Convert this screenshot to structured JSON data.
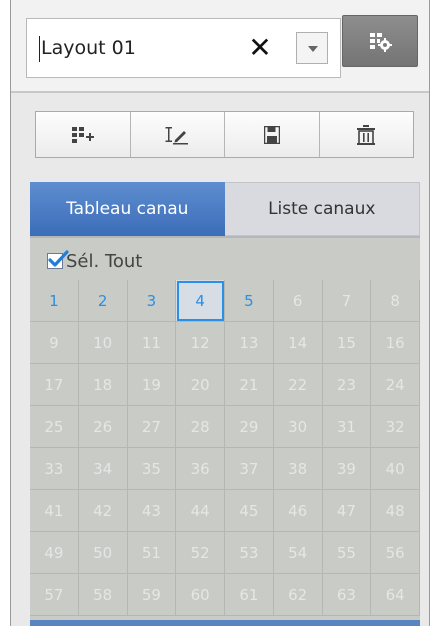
{
  "layout": {
    "value": "Layout 01",
    "clear_glyph": "✕"
  },
  "toolbar": {
    "tools": [
      {
        "name": "add-layout-icon"
      },
      {
        "name": "rename-layout-icon"
      },
      {
        "name": "save-layout-icon"
      },
      {
        "name": "delete-layout-icon"
      }
    ]
  },
  "tabs": {
    "channel_table": "Tableau canau",
    "channel_list": "Liste canaux"
  },
  "grid": {
    "select_all": "Sél. Tout",
    "channels": [
      "1",
      "2",
      "3",
      "4",
      "5",
      "6",
      "7",
      "8",
      "9",
      "10",
      "11",
      "12",
      "13",
      "14",
      "15",
      "16",
      "17",
      "18",
      "19",
      "20",
      "21",
      "22",
      "23",
      "24",
      "25",
      "26",
      "27",
      "28",
      "29",
      "30",
      "31",
      "32",
      "33",
      "34",
      "35",
      "36",
      "37",
      "38",
      "39",
      "40",
      "41",
      "42",
      "43",
      "44",
      "45",
      "46",
      "47",
      "48",
      "49",
      "50",
      "51",
      "52",
      "53",
      "54",
      "55",
      "56",
      "57",
      "58",
      "59",
      "60",
      "61",
      "62",
      "63",
      "64"
    ],
    "active_channels": [
      1,
      2,
      3,
      4,
      5
    ],
    "selected_channel": 4
  },
  "colors": {
    "accent": "#3b6db8",
    "active_channel": "#2a8fe6",
    "inactive_channel": "#e6e6e6"
  }
}
